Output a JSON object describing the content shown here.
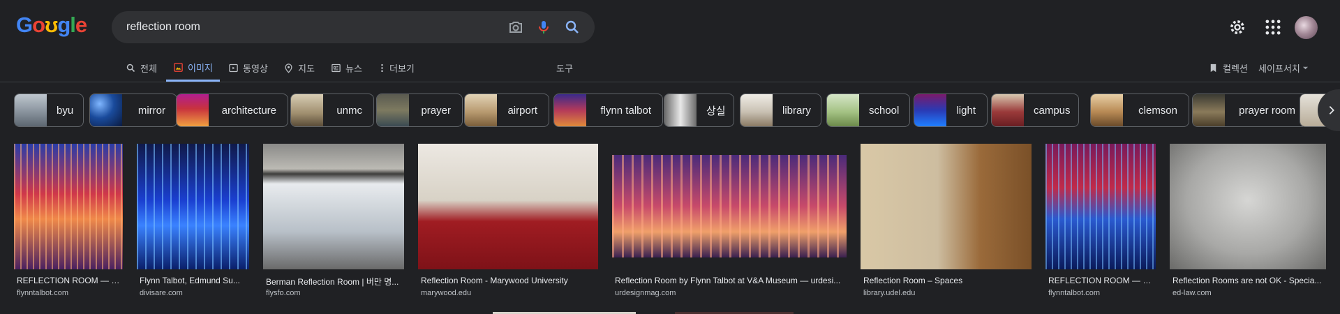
{
  "search": {
    "query": "reflection room"
  },
  "tabs": [
    {
      "label": "전체",
      "icon": "search-icon"
    },
    {
      "label": "이미지",
      "icon": "image-icon"
    },
    {
      "label": "동영상",
      "icon": "video-icon"
    },
    {
      "label": "지도",
      "icon": "map-pin-icon"
    },
    {
      "label": "뉴스",
      "icon": "news-icon"
    },
    {
      "label": "더보기",
      "icon": "more-vert-icon"
    }
  ],
  "tools_label": "도구",
  "collections_label": "컬렉션",
  "safesearch_label": "세이프서치",
  "chips": [
    {
      "label": "byu"
    },
    {
      "label": "mirror"
    },
    {
      "label": "architecture"
    },
    {
      "label": "unmc"
    },
    {
      "label": "prayer"
    },
    {
      "label": "airport"
    },
    {
      "label": "flynn talbot"
    },
    {
      "label": "상실"
    },
    {
      "label": "library"
    },
    {
      "label": "school"
    },
    {
      "label": "light"
    },
    {
      "label": "campus"
    },
    {
      "label": "clemson"
    },
    {
      "label": "prayer room"
    }
  ],
  "results": [
    {
      "title": "REFLECTION ROOM — FL...",
      "source": "flynntalbot.com"
    },
    {
      "title": "Flynn Talbot, Edmund Su...",
      "source": "divisare.com"
    },
    {
      "title": "Berman Reflection Room | 버만 명...",
      "source": "flysfo.com"
    },
    {
      "title": "Reflection Room - Marywood University",
      "source": "marywood.edu"
    },
    {
      "title": "Reflection Room by Flynn Talbot at V&A Museum — urdesi...",
      "source": "urdesignmag.com"
    },
    {
      "title": "Reflection Room – Spaces",
      "source": "library.udel.edu"
    },
    {
      "title": "REFLECTION ROOM — FL...",
      "source": "flynntalbot.com"
    },
    {
      "title": "Reflection Rooms are not OK - Specia...",
      "source": "ed-law.com"
    }
  ],
  "colors": {
    "background": "#202124",
    "accent": "#8ab4f8",
    "chip_border": "#5f6368"
  }
}
